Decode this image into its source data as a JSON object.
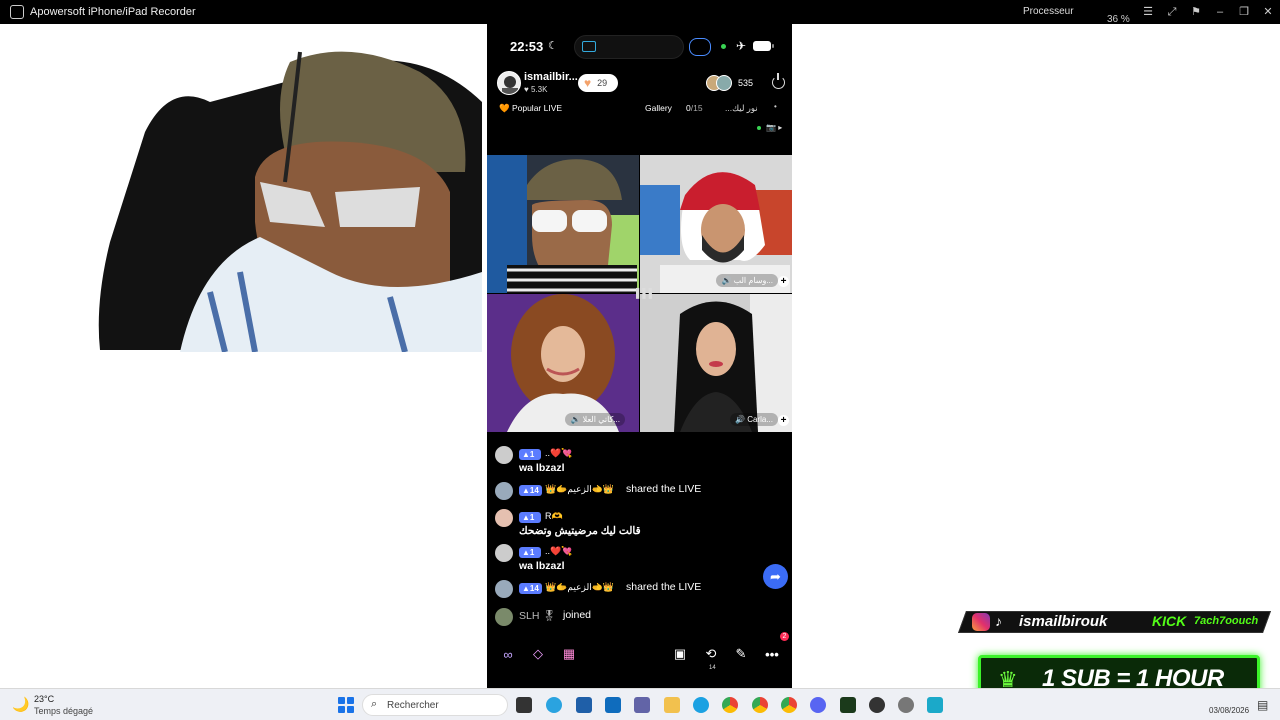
{
  "window": {
    "title": "Apowersoft iPhone/iPad Recorder",
    "cpu_label": "Processeur",
    "cpu_value": "36 %"
  },
  "phone": {
    "status": {
      "time": "22:53"
    },
    "host": {
      "name": "ismailbir...",
      "likes": "5.3K",
      "follow_count": "29"
    },
    "viewers": "535",
    "popular_label": "Popular LIVE",
    "gallery_label": "Gallery",
    "gallery_count": "0",
    "gallery_total": "/15",
    "rtl_label": "...نور ليك",
    "tiles": [
      {
        "label": ""
      },
      {
        "label": "وسام الب..."
      },
      {
        "label": "كاتي العلا..."
      },
      {
        "label": "Carla..."
      }
    ],
    "chat": [
      {
        "level": "1",
        "nick": "..❤️💘",
        "text": "wa lbzazl"
      },
      {
        "level": "14",
        "nick": "👑🫱الزعيم🫲👑",
        "text": "shared the LIVE"
      },
      {
        "level": "1",
        "nick": "R🫶",
        "text": "قالت ليك مرضيتيش وتضحك"
      },
      {
        "level": "1",
        "nick": "..❤️💘",
        "text": "wa lbzazl"
      },
      {
        "level": "14",
        "nick": "👑🫱الزعيم🫲👑",
        "text": "shared the LIVE"
      },
      {
        "nick": "SLH 🎖",
        "text": "joined"
      }
    ],
    "bottom": {
      "notif_count": "2",
      "repost_count": "14"
    }
  },
  "overlay": {
    "handle": "ismailbirouk",
    "kick_label": "KICK",
    "kick_handle": "7ach7oouch",
    "sub_text": "1 SUB = 1 HOUR"
  },
  "taskbar": {
    "temp": "23°C",
    "condition": "Temps dégagé",
    "search_placeholder": "Rechercher",
    "date": "03/08/2026"
  }
}
